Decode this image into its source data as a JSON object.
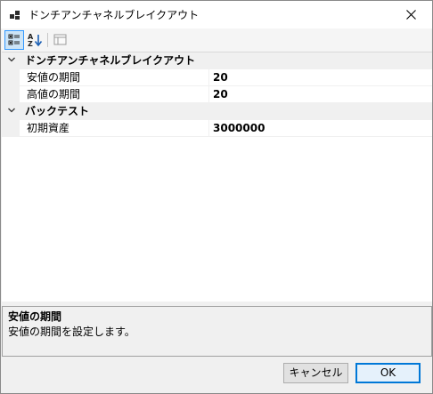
{
  "window": {
    "title": "ドンチアンチャネルブレイクアウト"
  },
  "toolbar": {
    "buttons": [
      {
        "name": "categorized-view",
        "icon": "categorized-icon",
        "active": true
      },
      {
        "name": "alphabetical-sort",
        "icon": "sort-az-icon",
        "active": false
      },
      {
        "name": "property-pages",
        "icon": "property-pages-icon",
        "active": false
      }
    ]
  },
  "grid": {
    "categories": [
      {
        "label": "ドンチアンチャネルブレイクアウト",
        "expanded": true,
        "properties": [
          {
            "name": "安値の期間",
            "value": "20"
          },
          {
            "name": "高値の期間",
            "value": "20"
          }
        ]
      },
      {
        "label": "バックテスト",
        "expanded": true,
        "properties": [
          {
            "name": "初期資産",
            "value": "3000000"
          }
        ]
      }
    ]
  },
  "help": {
    "title": "安値の期間",
    "description": "安値の期間を設定します。"
  },
  "buttons": {
    "cancel": "キャンセル",
    "ok": "OK"
  },
  "colors": {
    "accent": "#0078d7",
    "selection_bg": "#cce4f7",
    "category_bg": "#f0f0f0"
  }
}
